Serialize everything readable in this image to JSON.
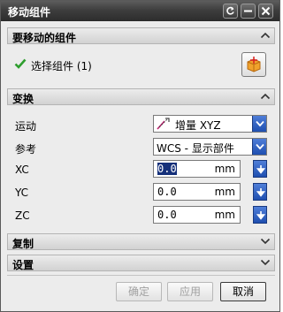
{
  "window": {
    "title": "移动组件"
  },
  "sections": {
    "components": {
      "label": "要移动的组件"
    },
    "transform": {
      "label": "变换"
    },
    "copy": {
      "label": "复制"
    },
    "settings": {
      "label": "设置"
    }
  },
  "select_component": {
    "label": "选择组件 (1)",
    "icon": "check-icon"
  },
  "motion": {
    "label": "运动",
    "value": "增量 XYZ"
  },
  "reference": {
    "label": "参考",
    "value": "WCS - 显示部件"
  },
  "xc": {
    "label": "XC",
    "value": "0.0",
    "unit": "mm"
  },
  "yc": {
    "label": "YC",
    "value": "0.0",
    "unit": "mm"
  },
  "zc": {
    "label": "ZC",
    "value": "0.0",
    "unit": "mm"
  },
  "buttons": {
    "ok": "确定",
    "apply": "应用",
    "cancel": "取消"
  },
  "colors": {
    "accent": "#1f4fb0",
    "title_bar": "#3e3e3e",
    "check": "#2e9e2e",
    "selection": "#15307a"
  }
}
